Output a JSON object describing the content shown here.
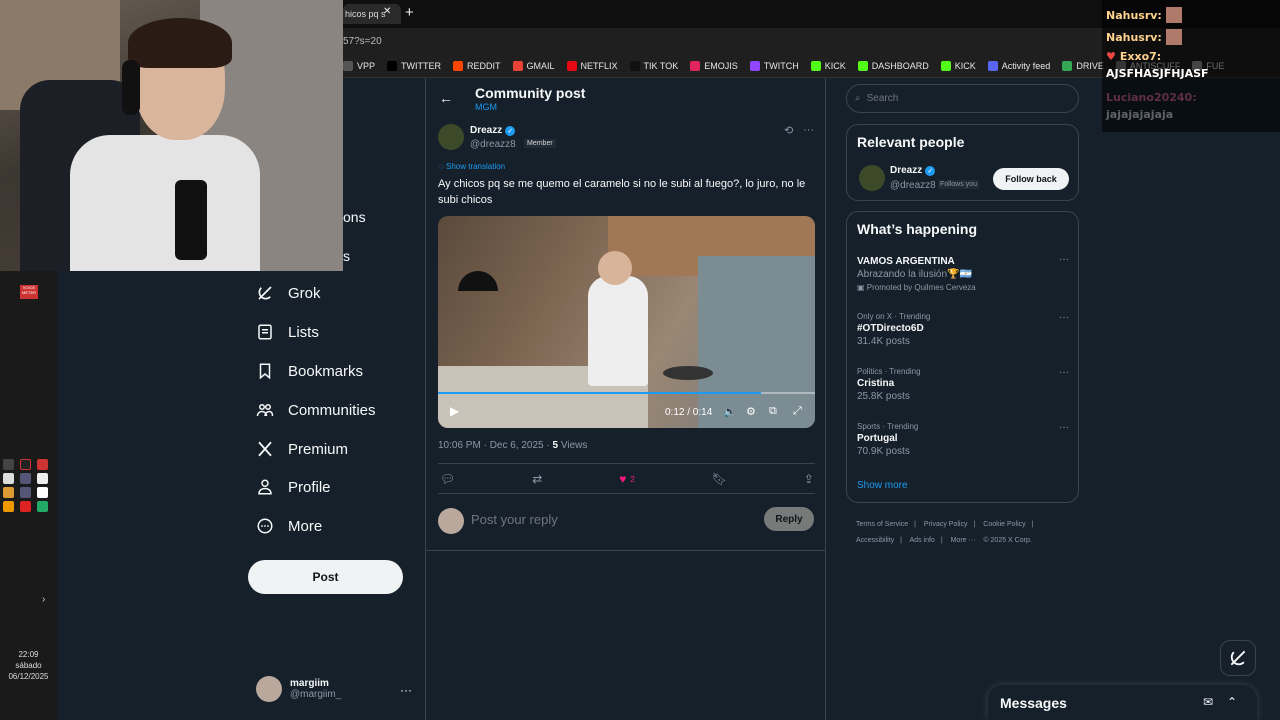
{
  "browser": {
    "tab_title": "hicos pq s",
    "address_text": "57?s=20",
    "bookmarks": [
      {
        "label": "VPP",
        "color": "#555555"
      },
      {
        "label": "TWITTER",
        "color": "#000000"
      },
      {
        "label": "REDDIT",
        "color": "#ff4500"
      },
      {
        "label": "GMAIL",
        "color": "#ea4335"
      },
      {
        "label": "NETFLIX",
        "color": "#e50914"
      },
      {
        "label": "TIK TOK",
        "color": "#111111"
      },
      {
        "label": "EMOJIS",
        "color": "#e0245e"
      },
      {
        "label": "TWITCH",
        "color": "#9146ff"
      },
      {
        "label": "KICK",
        "color": "#53fc18"
      },
      {
        "label": "DASHBOARD",
        "color": "#53fc18"
      },
      {
        "label": "KICK",
        "color": "#53fc18"
      },
      {
        "label": "Activity feed",
        "color": "#5865f2"
      },
      {
        "label": "DRIVE",
        "color": "#34a853"
      },
      {
        "label": "ANTISCUFF",
        "color": "#777777"
      },
      {
        "label": "FUE",
        "color": "#999999"
      }
    ]
  },
  "taskbar": {
    "time": "22:09",
    "day": "sábado",
    "date": "06/12/2025",
    "badge_text": "VOICE METER"
  },
  "nav": {
    "partial_1": "ons",
    "partial_2": "s",
    "items": [
      {
        "label": "Grok",
        "icon": "grok-icon"
      },
      {
        "label": "Lists",
        "icon": "lists-icon"
      },
      {
        "label": "Bookmarks",
        "icon": "bookmark-icon"
      },
      {
        "label": "Communities",
        "icon": "communities-icon"
      },
      {
        "label": "Premium",
        "icon": "x-logo-icon"
      },
      {
        "label": "Profile",
        "icon": "profile-icon"
      },
      {
        "label": "More",
        "icon": "more-circle-icon"
      }
    ],
    "post_label": "Post",
    "account_name": "margiim",
    "account_handle": "@margiim_"
  },
  "main": {
    "title": "Community post",
    "subtitle": "MGM",
    "tweet": {
      "author": "Dreazz",
      "handle": "@dreazz8",
      "badge": "Member",
      "show_translation": "Show translation",
      "text": "Ay chicos pq se me quemo el caramelo si no le subi al fuego?, lo juro, no le subi chicos",
      "video_time": "0:12 / 0:14",
      "video_progress": 0.857,
      "timestamp": "10:06 PM · Dec 6, 2025 · ",
      "views_count": "5",
      "views_label": " Views",
      "likes": "2"
    },
    "reply_placeholder": "Post your reply",
    "reply_label": "Reply"
  },
  "right": {
    "search_placeholder": "Search",
    "relevant_title": "Relevant people",
    "person": {
      "name": "Dreazz",
      "handle": "@dreazz8",
      "follows_you": "Follows you",
      "follow_label": "Follow back"
    },
    "happening_title": "What’s happening",
    "trends": [
      {
        "top": "",
        "title": "VAMOS ARGENTINA",
        "sub": "Abrazando la ilusión🏆🇦🇷",
        "promo": "Promoted by Quilmes Cerveza"
      },
      {
        "top": "Only on X · Trending",
        "title": "#OTDirecto6D",
        "sub": "31.4K posts",
        "promo": ""
      },
      {
        "top": "Politics · Trending",
        "title": "Cristina",
        "sub": "25.8K posts",
        "promo": ""
      },
      {
        "top": "Sports · Trending",
        "title": "Portugal",
        "sub": "70.9K posts",
        "promo": ""
      }
    ],
    "show_more": "Show more",
    "footer": [
      "Terms of Service",
      "Privacy Policy",
      "Cookie Policy",
      "Accessibility",
      "Ads info",
      "More ···",
      "© 2025 X Corp."
    ]
  },
  "messages": {
    "title": "Messages"
  },
  "chat": [
    {
      "user": "Nahusrv:",
      "msg": ""
    },
    {
      "user": "Nahusrv:",
      "msg": ""
    },
    {
      "user": "Exxo7:",
      "msg": "AJSFHASJFHJASF"
    },
    {
      "user": "Luciano20240:",
      "msg": "jajajajajaja"
    }
  ],
  "colors": {
    "background": "#15202b",
    "accent": "#1d9bf0",
    "like": "#f91880"
  }
}
